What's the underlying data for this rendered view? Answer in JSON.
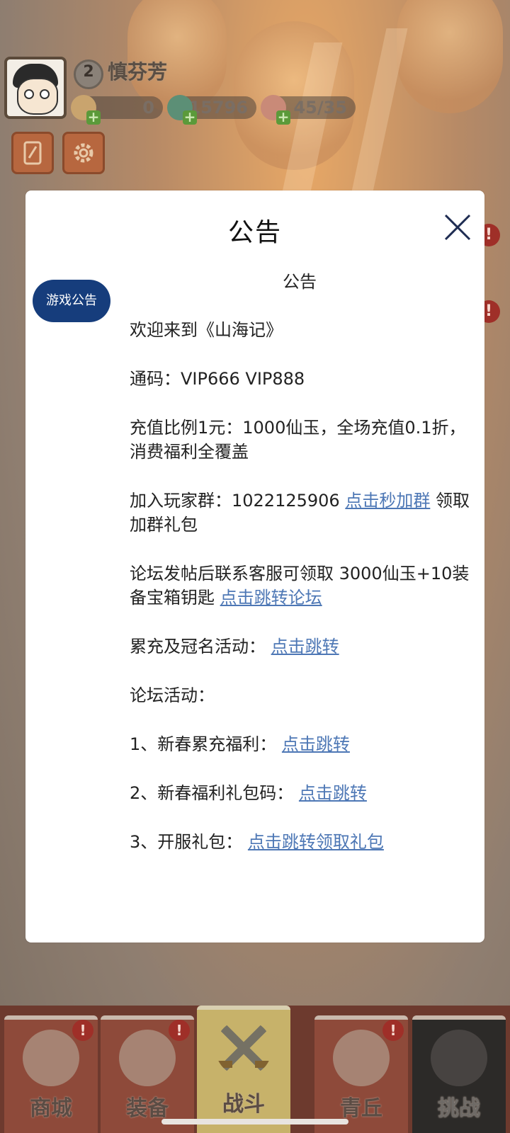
{
  "player": {
    "level": "2",
    "name": "慎芬芳",
    "resources": [
      {
        "icon": "scroll-coin-icon",
        "value": "0"
      },
      {
        "icon": "jade-dragon-icon",
        "value": "15796"
      },
      {
        "icon": "peach-icon",
        "value": "45/35"
      }
    ]
  },
  "modal": {
    "title": "公告",
    "side_tab": "游戏公告",
    "subtitle": "公告",
    "lines": {
      "welcome": "欢迎来到《山海记》",
      "codes": "通码：VIP666 VIP888",
      "recharge": "充值比例1元：1000仙玉，全场充值0.1折，消费福利全覆盖",
      "group_prefix": "加入玩家群：1022125906 ",
      "group_link": "点击秒加群",
      "group_suffix": " 领取加群礼包",
      "forum_prefix": "论坛发帖后联系客服可领取 3000仙玉+10装备宝箱钥匙 ",
      "forum_link": "点击跳转论坛",
      "activity_prefix": "累充及冠名活动： ",
      "activity_link": "点击跳转",
      "forum_events": "论坛活动：",
      "item1_prefix": "1、新春累充福利： ",
      "item1_link": "点击跳转",
      "item2_prefix": "2、新春福利礼包码： ",
      "item2_link": "点击跳转",
      "item3_prefix": "3、开服礼包： ",
      "item3_link": "点击跳转领取礼包"
    }
  },
  "nav": [
    {
      "label": "商城",
      "alert": "!"
    },
    {
      "label": "装备",
      "alert": "!"
    },
    {
      "label": "战斗",
      "alert": ""
    },
    {
      "label": "青丘",
      "alert": "!"
    },
    {
      "label": "挑战",
      "alert": ""
    }
  ],
  "side_alerts": [
    "!",
    "!"
  ],
  "colors": {
    "link": "#4d77b5",
    "tab": "#163d7c",
    "overlay": "#8a7a6c"
  }
}
